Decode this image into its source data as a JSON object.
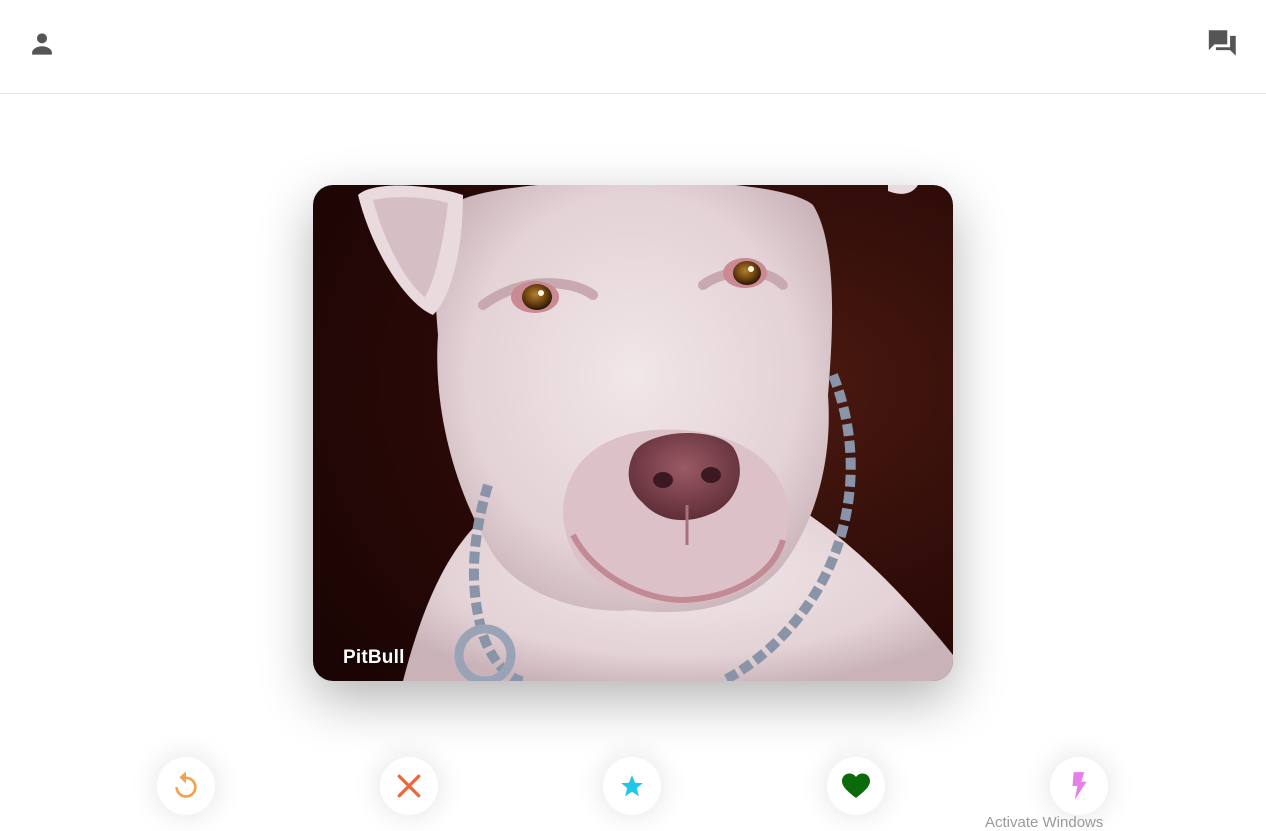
{
  "header": {
    "profile_icon": "person-icon",
    "chats_icon": "forum-icon",
    "icon_color": "#555555"
  },
  "card": {
    "name": "PitBull",
    "image": "white pit bull dog wearing a chain collar"
  },
  "actions": [
    {
      "id": "rewind",
      "icon": "replay-icon",
      "color": "#f5a34a"
    },
    {
      "id": "nope",
      "icon": "close-icon",
      "color": "#f0643c"
    },
    {
      "id": "super-like",
      "icon": "star-icon",
      "color": "#1ec8e6"
    },
    {
      "id": "like",
      "icon": "heart-icon",
      "color": "#0b6b0b"
    },
    {
      "id": "boost",
      "icon": "flash-icon",
      "color": "#e77de8"
    }
  ],
  "watermark": {
    "text": "Activate Windows"
  }
}
